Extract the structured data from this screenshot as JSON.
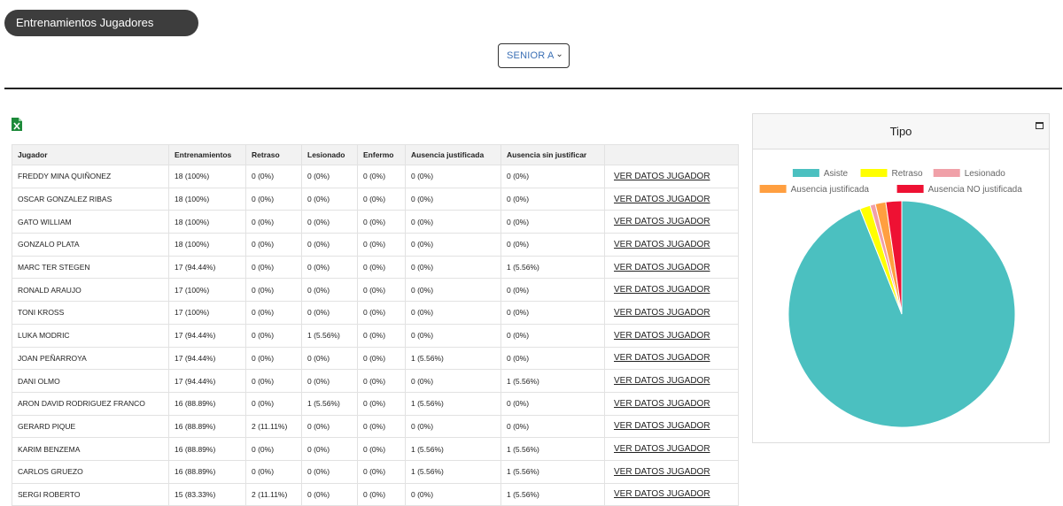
{
  "header": {
    "title": "Entrenamientos Jugadores"
  },
  "team_select": {
    "value": "SENIOR A"
  },
  "table": {
    "columns": [
      "Jugador",
      "Entrenamientos",
      "Retraso",
      "Lesionado",
      "Enfermo",
      "Ausencia justificada",
      "Ausencia sin justificar",
      ""
    ],
    "link_label": "VER DATOS JUGADOR",
    "rows": [
      [
        "FREDDY MINA QUIÑONEZ",
        "18 (100%)",
        "0 (0%)",
        "0 (0%)",
        "0 (0%)",
        "0 (0%)",
        "0 (0%)"
      ],
      [
        "OSCAR GONZALEZ RIBAS",
        "18 (100%)",
        "0 (0%)",
        "0 (0%)",
        "0 (0%)",
        "0 (0%)",
        "0 (0%)"
      ],
      [
        "GATO WILLIAM",
        "18 (100%)",
        "0 (0%)",
        "0 (0%)",
        "0 (0%)",
        "0 (0%)",
        "0 (0%)"
      ],
      [
        "GONZALO PLATA",
        "18 (100%)",
        "0 (0%)",
        "0 (0%)",
        "0 (0%)",
        "0 (0%)",
        "0 (0%)"
      ],
      [
        "MARC TER STEGEN",
        "17 (94.44%)",
        "0 (0%)",
        "0 (0%)",
        "0 (0%)",
        "0 (0%)",
        "1 (5.56%)"
      ],
      [
        "RONALD ARAUJO",
        "17 (100%)",
        "0 (0%)",
        "0 (0%)",
        "0 (0%)",
        "0 (0%)",
        "0 (0%)"
      ],
      [
        "TONI KROSS",
        "17 (100%)",
        "0 (0%)",
        "0 (0%)",
        "0 (0%)",
        "0 (0%)",
        "0 (0%)"
      ],
      [
        "LUKA MODRIC",
        "17 (94.44%)",
        "0 (0%)",
        "1 (5.56%)",
        "0 (0%)",
        "0 (0%)",
        "0 (0%)"
      ],
      [
        "JOAN PEÑARROYA",
        "17 (94.44%)",
        "0 (0%)",
        "0 (0%)",
        "0 (0%)",
        "1 (5.56%)",
        "0 (0%)"
      ],
      [
        "DANI OLMO",
        "17 (94.44%)",
        "0 (0%)",
        "0 (0%)",
        "0 (0%)",
        "0 (0%)",
        "1 (5.56%)"
      ],
      [
        "ARON DAVID RODRIGUEZ FRANCO",
        "16 (88.89%)",
        "0 (0%)",
        "1 (5.56%)",
        "0 (0%)",
        "1 (5.56%)",
        "0 (0%)"
      ],
      [
        "GERARD PIQUE",
        "16 (88.89%)",
        "2 (11.11%)",
        "0 (0%)",
        "0 (0%)",
        "0 (0%)",
        "0 (0%)"
      ],
      [
        "KARIM BENZEMA",
        "16 (88.89%)",
        "0 (0%)",
        "0 (0%)",
        "0 (0%)",
        "1 (5.56%)",
        "1 (5.56%)"
      ],
      [
        "CARLOS GRUEZO",
        "16 (88.89%)",
        "0 (0%)",
        "0 (0%)",
        "0 (0%)",
        "1 (5.56%)",
        "1 (5.56%)"
      ],
      [
        "SERGI ROBERTO",
        "15 (83.33%)",
        "2 (11.11%)",
        "0 (0%)",
        "0 (0%)",
        "0 (0%)",
        "1 (5.56%)"
      ]
    ]
  },
  "chart": {
    "title": "Tipo"
  },
  "chart_data": {
    "type": "pie",
    "title": "Tipo",
    "labels": [
      "Asiste",
      "Retraso",
      "Lesionado",
      "Ausencia justificada",
      "Ausencia NO justificada"
    ],
    "values": [
      250,
      4,
      2,
      4,
      6
    ],
    "colors": [
      "#4bc0c0",
      "#ffff00",
      "#f0a0a8",
      "#ff9f40",
      "#ee1133"
    ],
    "legend_position": "top"
  },
  "icons": {
    "export": "excel-icon",
    "collapse": "collapse-icon",
    "dropdown": "chevron-down-icon"
  }
}
